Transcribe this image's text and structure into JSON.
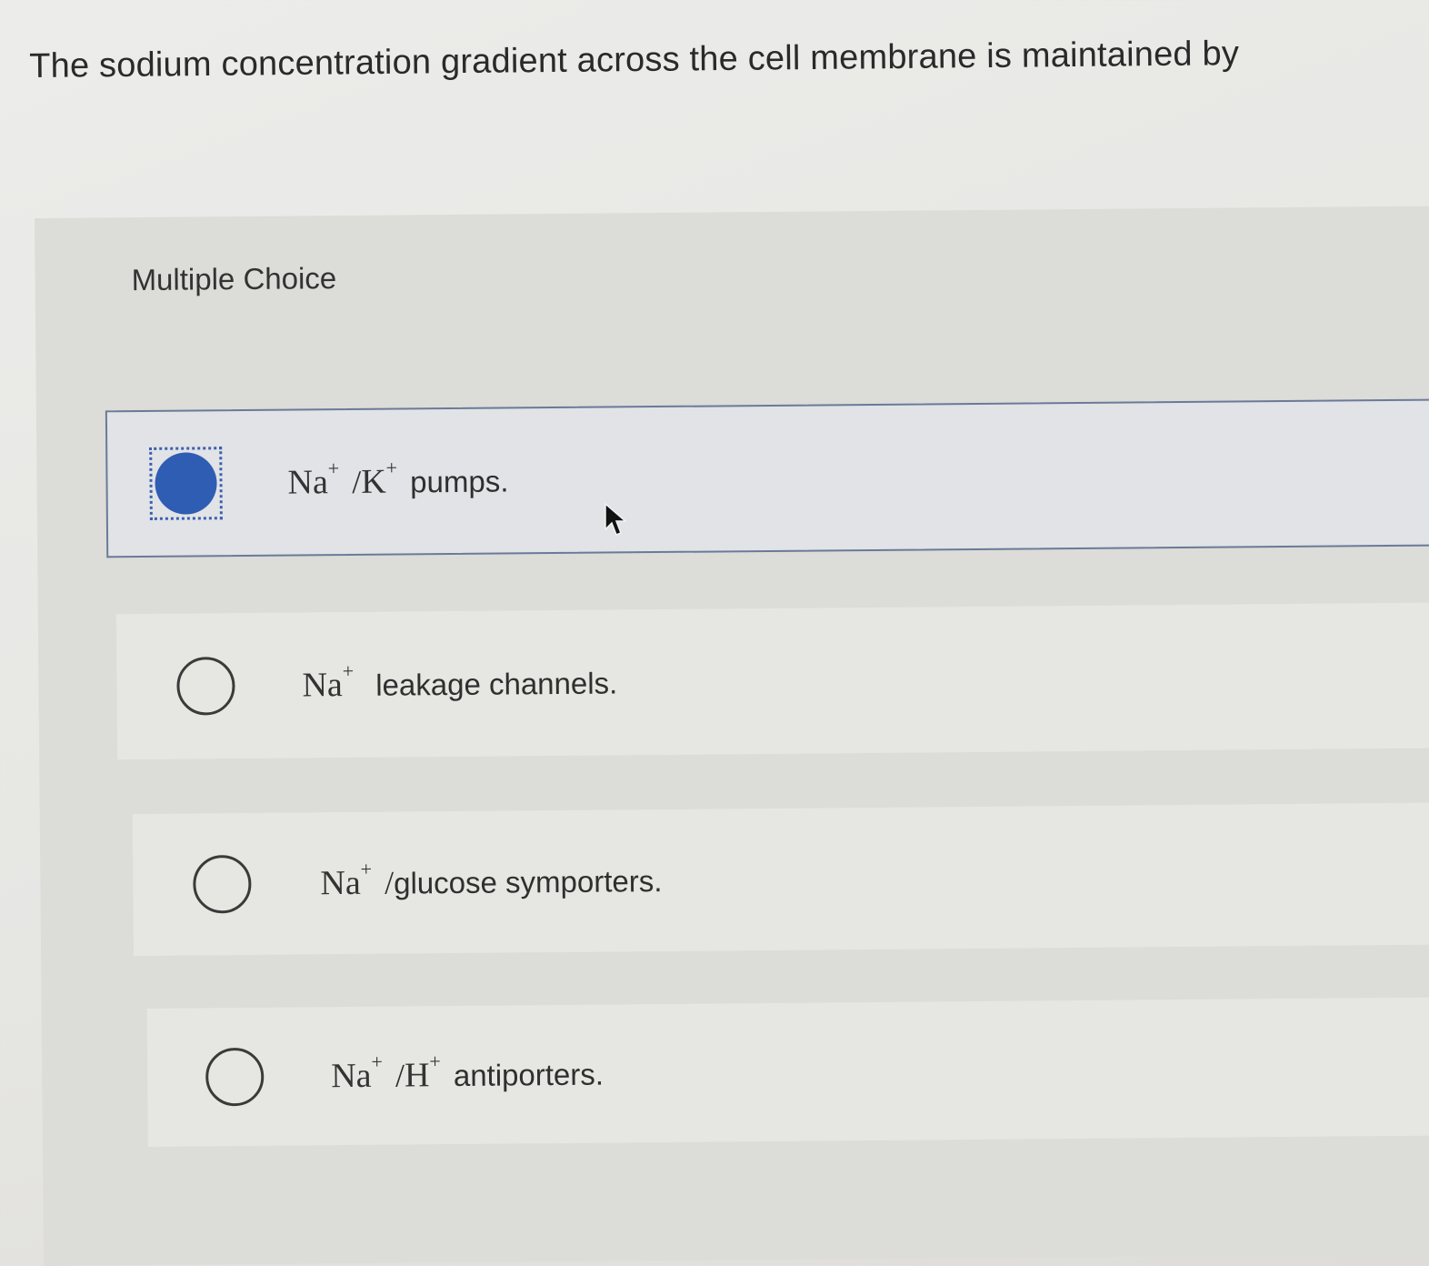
{
  "question": {
    "text": "The sodium concentration gradient across the cell membrane is maintained by"
  },
  "panel": {
    "label": "Multiple Choice"
  },
  "options": [
    {
      "ion1": "Na",
      "charge1": "+",
      "sep": "/",
      "ion2": "K",
      "charge2": "+",
      "desc": "pumps.",
      "selected": true
    },
    {
      "ion1": "Na",
      "charge1": "+",
      "desc": "leakage channels.",
      "selected": false
    },
    {
      "ion1": "Na",
      "charge1": "+",
      "sep": "/",
      "desc": "glucose symporters.",
      "selected": false
    },
    {
      "ion1": "Na",
      "charge1": "+",
      "sep": "/",
      "ion2": "H",
      "charge2": "+",
      "desc": "antiporters.",
      "selected": false
    }
  ],
  "colors": {
    "selected_radio": "#2f5db3",
    "selected_border": "#6a7a98",
    "focus_outline": "#3d5fb0"
  },
  "icons": {
    "cursor": "mouse-pointer-icon"
  }
}
